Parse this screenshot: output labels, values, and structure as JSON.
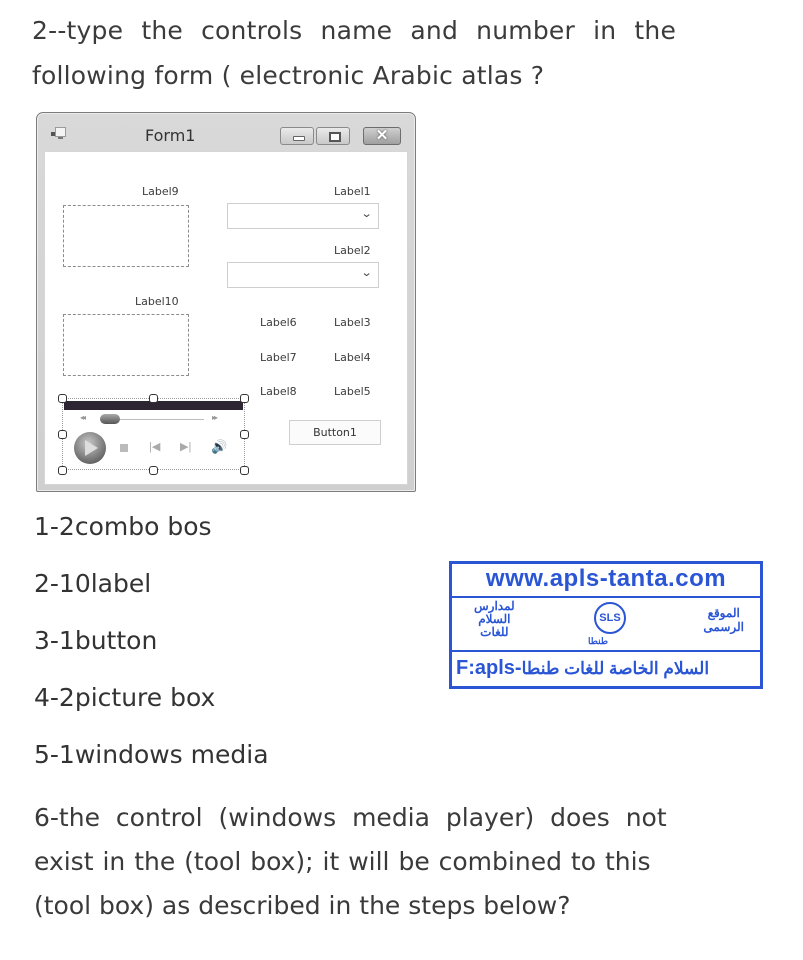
{
  "question": {
    "line1": "2--type the controls name and number in the",
    "line2": "following form ( electronic Arabic atlas ?"
  },
  "window": {
    "title": "Form1",
    "buttons": {
      "minimize": "minimize",
      "maximize": "maximize",
      "close": "✕"
    },
    "labels": {
      "label1": "Label1",
      "label2": "Label2",
      "label3": "Label3",
      "label4": "Label4",
      "label5": "Label5",
      "label6": "Label6",
      "label7": "Label7",
      "label8": "Label8",
      "label9": "Label9",
      "label10": "Label10"
    },
    "combo_chevron": "⌄",
    "button1": "Button1",
    "media_player": {
      "rewind": "◂◂",
      "fast_forward": "▸▸",
      "prev": "|◀",
      "next": "▶|",
      "volume": "🔊"
    }
  },
  "answers": [
    "1-2combo bos",
    "2-10label",
    "3-1button",
    "4-2picture box",
    "5-1windows media"
  ],
  "stamp": {
    "url": "www.apls-tanta.com",
    "left_text": [
      "لمدارس",
      "السلام",
      "للغات"
    ],
    "logo": "SLS",
    "logo_caption": "طنطا",
    "right_text": [
      "الموقع",
      "الرسمى"
    ],
    "bottom_prefix": "F:apls-",
    "bottom_arabic": "السلام الخاصة للغات طنطا",
    "color": "#2a55d4"
  },
  "question6": {
    "line1": "6-the control (windows media player) does not",
    "line2": "exist in the (tool box); it will be combined to this",
    "line3": "(tool box) as described in the steps below?"
  }
}
